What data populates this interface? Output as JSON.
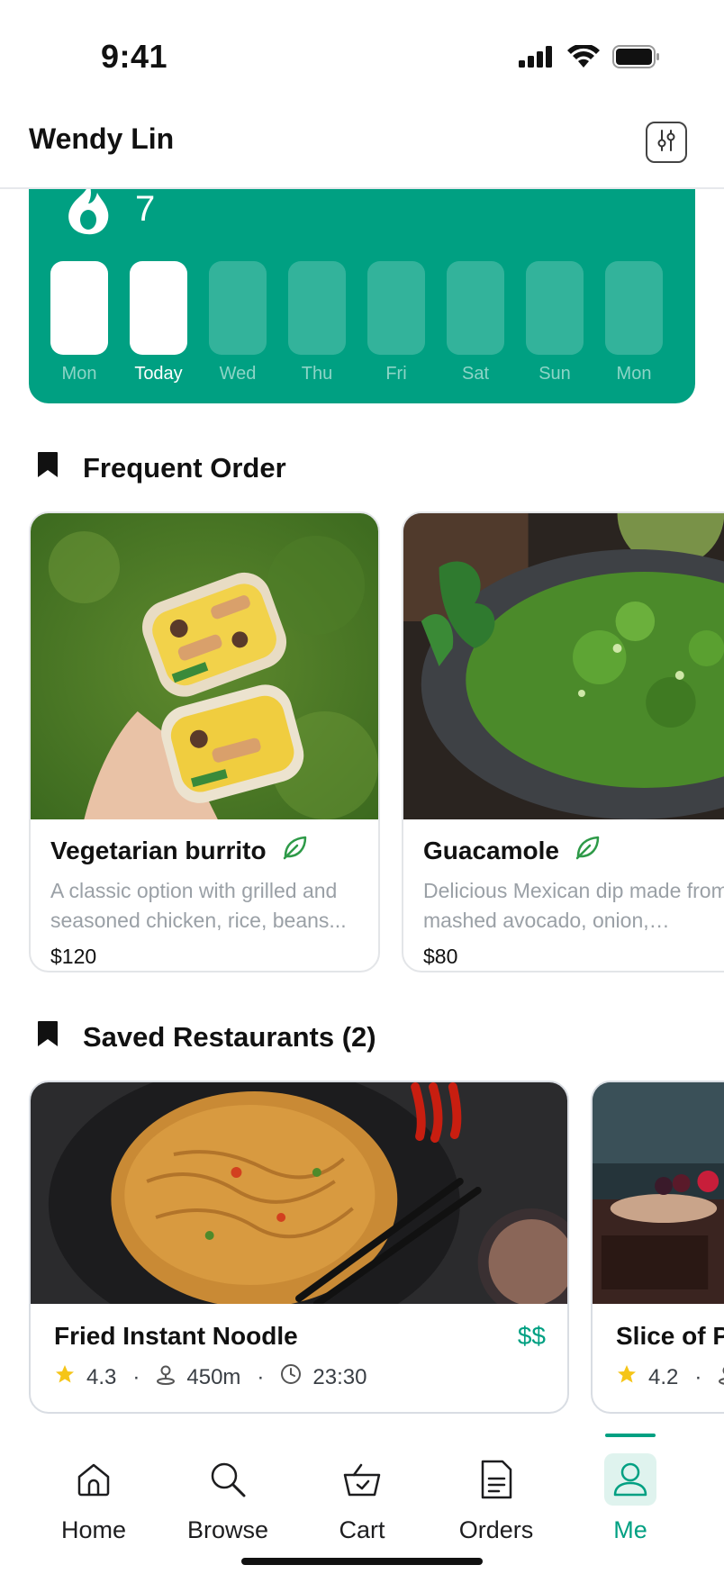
{
  "status_bar": {
    "time": "9:41"
  },
  "header": {
    "title": "Wendy Lin",
    "action_icon": "settings-sliders-icon"
  },
  "streak": {
    "count": "7",
    "days": [
      {
        "label": "Mon",
        "done": true,
        "today": false
      },
      {
        "label": "Today",
        "done": true,
        "today": true
      },
      {
        "label": "Wed",
        "done": false,
        "today": false
      },
      {
        "label": "Thu",
        "done": false,
        "today": false
      },
      {
        "label": "Fri",
        "done": false,
        "today": false
      },
      {
        "label": "Sat",
        "done": false,
        "today": false
      },
      {
        "label": "Sun",
        "done": false,
        "today": false
      },
      {
        "label": "Mon",
        "done": false,
        "today": false
      }
    ]
  },
  "frequent_order": {
    "title": "Frequent Order",
    "items": [
      {
        "name": "Vegetarian burrito",
        "description": "A classic option with grilled and seasoned chicken, rice, beans...",
        "price": "$120"
      },
      {
        "name": "Guacamole",
        "description": "Delicious Mexican dip made from mashed avocado, onion, tomato...",
        "price": "$80"
      }
    ]
  },
  "saved_restaurants": {
    "title": "Saved Restaurants (2)",
    "items": [
      {
        "name": "Fried Instant Noodle",
        "price_level": "$$",
        "rating": "4.3",
        "distance": "450m",
        "time": "23:30"
      },
      {
        "name": "Slice of P",
        "price_level": "",
        "rating": "4.2",
        "distance": "",
        "time": ""
      }
    ]
  },
  "tab_bar": {
    "tabs": [
      {
        "label": "Home",
        "icon": "home-icon",
        "active": false
      },
      {
        "label": "Browse",
        "icon": "search-icon",
        "active": false
      },
      {
        "label": "Cart",
        "icon": "basket-icon",
        "active": false
      },
      {
        "label": "Orders",
        "icon": "document-icon",
        "active": false
      },
      {
        "label": "Me",
        "icon": "user-icon",
        "active": true
      }
    ]
  },
  "colors": {
    "accent": "#00a082",
    "accent_light": "#dff3ee",
    "veg_icon": "#2e9a48",
    "star": "#f5c518"
  }
}
